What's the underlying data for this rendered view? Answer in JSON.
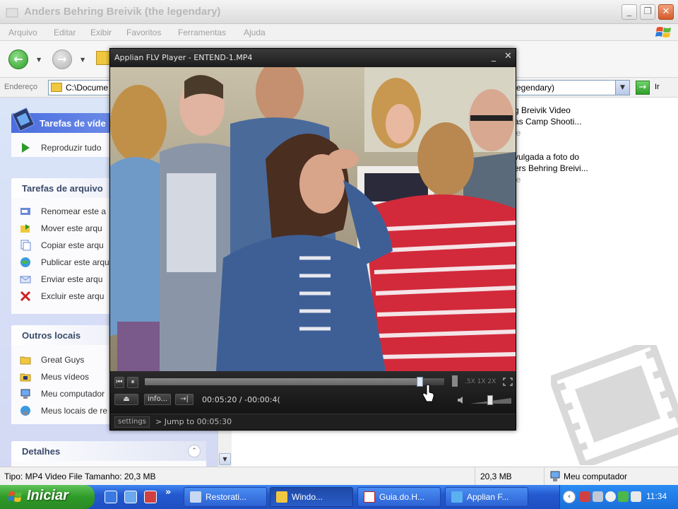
{
  "window": {
    "title": "Anders Behring Breivik (the legendary)",
    "min_label": "_",
    "max_label": "❐",
    "close_label": "✕"
  },
  "menu": [
    "Arquivo",
    "Editar",
    "Exibir",
    "Favoritos",
    "Ferramentas",
    "Ajuda"
  ],
  "address": {
    "label": "Endereço",
    "value_start": "C:\\Docume",
    "value_end": "egendary)",
    "go_label": "Ir"
  },
  "left_pane": {
    "video_tasks": {
      "title": "Tarefas de víde",
      "items": [
        {
          "label": "Reproduzir tudo",
          "icon": "play-icon"
        }
      ]
    },
    "file_tasks": {
      "title": "Tarefas de arquivo",
      "items": [
        {
          "label": "Renomear este a",
          "icon": "rename-icon"
        },
        {
          "label": "Mover este arqu",
          "icon": "move-icon"
        },
        {
          "label": "Copiar este arqu",
          "icon": "copy-icon"
        },
        {
          "label": "Publicar este arqu",
          "icon": "publish-web-icon"
        },
        {
          "label": "Enviar este arqu",
          "icon": "email-icon"
        },
        {
          "label": "Excluir este arqu",
          "icon": "delete-icon"
        }
      ]
    },
    "other_places": {
      "title": "Outros locais",
      "items": [
        {
          "label": "Great Guys",
          "icon": "folder-icon"
        },
        {
          "label": "Meus vídeos",
          "icon": "my-videos-icon"
        },
        {
          "label": "Meu computador",
          "icon": "my-computer-icon"
        },
        {
          "label": "Meus locais de re",
          "icon": "network-places-icon"
        }
      ]
    },
    "details": {
      "title": "Detalhes"
    }
  },
  "files": [
    {
      "line1": "g Breivik Video",
      "line2": "as Camp Shooti...",
      "line3": "le"
    },
    {
      "line1": "vulgada a foto do",
      "line2": "ers Behring Breivi...",
      "line3": "le"
    }
  ],
  "player": {
    "title": "Applian FLV Player - ENTEND-1.MP4",
    "min_label": "_",
    "close_label": "✕",
    "time": "00:05:20 / -00:00:4(",
    "info_label": "info...",
    "speed_labels": ".5X  1X  2X",
    "settings_label": "settings",
    "status_message": "> Jump to 00:05:30",
    "progress": 0.92,
    "volume": 0.55
  },
  "status_bar": {
    "description": "Tipo: MP4 Video File Tamanho: 20,3 MB",
    "size": "20,3 MB",
    "location": "Meu computador"
  },
  "taskbar": {
    "start_label": "Iniciar",
    "more_label": "»",
    "buttons": [
      {
        "label": "Restorati...",
        "active": false
      },
      {
        "label": "Windo...",
        "active": true
      },
      {
        "label": "Guia.do.H...",
        "active": false
      },
      {
        "label": "Applian F...",
        "active": false
      }
    ],
    "clock": "11:34"
  },
  "colors": {
    "xp_blue": "#2359d0",
    "start_green": "#2e9a28",
    "player_bg": "#1b1b1b",
    "task_header": "#3a4a6a"
  }
}
